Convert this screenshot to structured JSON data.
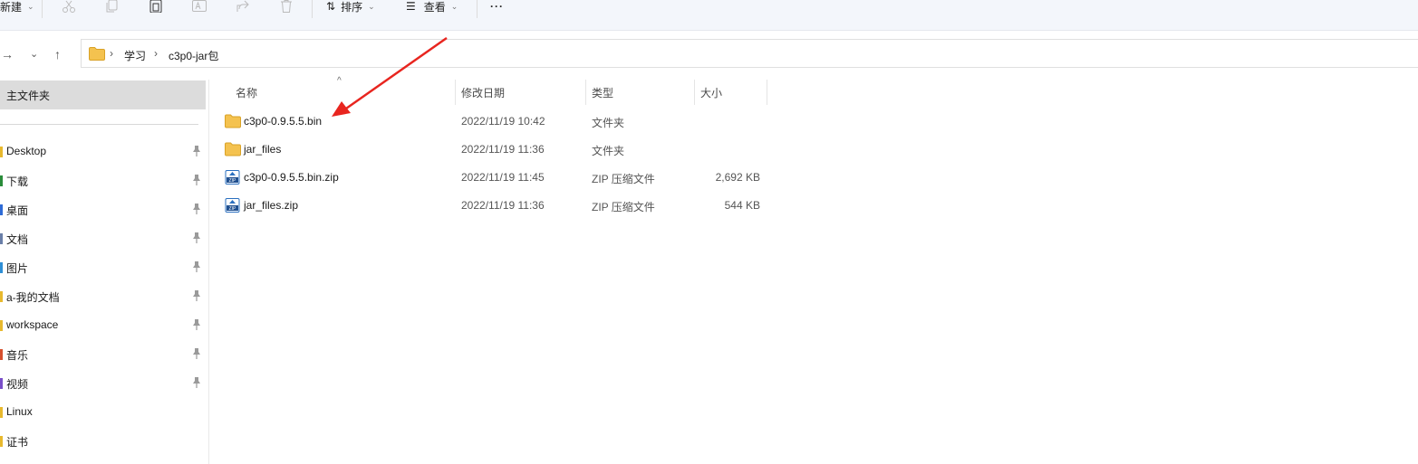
{
  "toolbar": {
    "new_label": "新建",
    "sort_label": "排序",
    "view_label": "查看",
    "more_label": "···"
  },
  "breadcrumb": [
    "学习",
    "c3p0-jar包"
  ],
  "sidebar": {
    "home": "主文件夹",
    "items": [
      {
        "label": "Desktop",
        "pinned": true,
        "color": "#e8b92e"
      },
      {
        "label": "下载",
        "pinned": true,
        "color": "#2a8c3a"
      },
      {
        "label": "桌面",
        "pinned": true,
        "color": "#2e6bd6"
      },
      {
        "label": "文档",
        "pinned": true,
        "color": "#6a7fa8"
      },
      {
        "label": "图片",
        "pinned": true,
        "color": "#2e8fd6"
      },
      {
        "label": "a-我的文档",
        "pinned": true,
        "color": "#e8b92e"
      },
      {
        "label": "workspace",
        "pinned": true,
        "color": "#e8b92e"
      },
      {
        "label": "音乐",
        "pinned": true,
        "color": "#d6502e"
      },
      {
        "label": "视频",
        "pinned": true,
        "color": "#7a4fc9"
      },
      {
        "label": "Linux",
        "pinned": false,
        "color": "#e8b92e"
      },
      {
        "label": "证书",
        "pinned": false,
        "color": "#e8b92e"
      }
    ]
  },
  "columns": {
    "name": "名称",
    "date": "修改日期",
    "type": "类型",
    "size": "大小"
  },
  "files": [
    {
      "name": "c3p0-0.9.5.5.bin",
      "date": "2022/11/19 10:42",
      "type": "文件夹",
      "size": "",
      "icon": "folder-icon"
    },
    {
      "name": "jar_files",
      "date": "2022/11/19 11:36",
      "type": "文件夹",
      "size": "",
      "icon": "folder-icon"
    },
    {
      "name": "c3p0-0.9.5.5.bin.zip",
      "date": "2022/11/19 11:45",
      "type": "ZIP 压缩文件",
      "size": "2,692 KB",
      "icon": "zip-icon"
    },
    {
      "name": "jar_files.zip",
      "date": "2022/11/19 11:36",
      "type": "ZIP 压缩文件",
      "size": "544 KB",
      "icon": "zip-icon"
    }
  ],
  "colors": {
    "accent": "#0067c0",
    "annotation_arrow": "#e8251f",
    "folder": "#f4c24f"
  }
}
